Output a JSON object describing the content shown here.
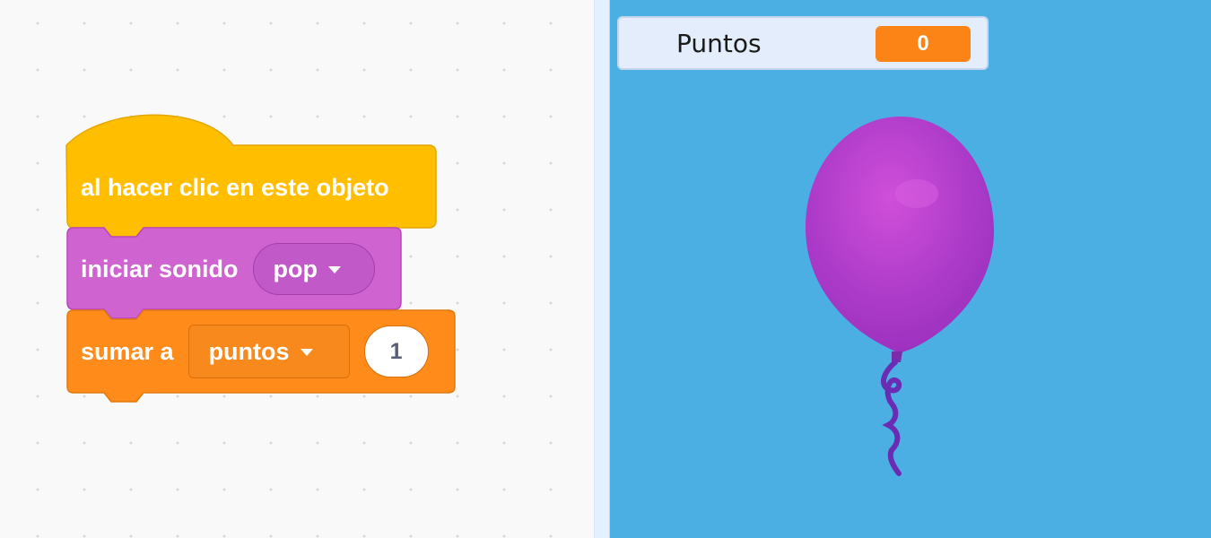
{
  "blocks": {
    "hat": {
      "label": "al hacer clic en este objeto",
      "color": "#ffbf00"
    },
    "sound": {
      "label": "iniciar sonido",
      "dropdown_value": "pop",
      "color": "#cf63cf"
    },
    "variable": {
      "label": "sumar a",
      "dropdown_value": "puntos",
      "amount": "1",
      "color": "#ff8c1a"
    }
  },
  "stage": {
    "monitor": {
      "label": "Puntos",
      "value": "0"
    },
    "background_color": "#4cafe3",
    "sprite": {
      "name": "balloon-icon",
      "color": "#a63cc7"
    }
  },
  "icons": {
    "dropdown_caret": "chevron-down-icon"
  }
}
